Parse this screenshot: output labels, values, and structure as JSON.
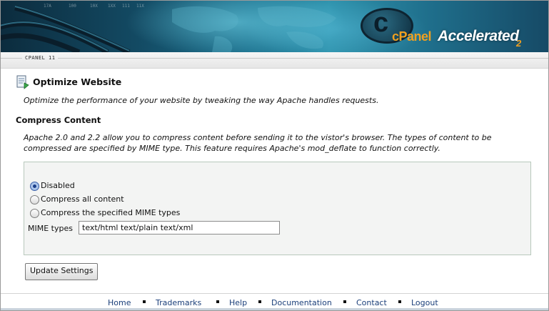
{
  "header": {
    "logo_c": "c",
    "logo_cpanel": "cPanel",
    "logo_accelerated": "Accelerated",
    "logo_version_num": "2",
    "version_strip": "CPANEL 11"
  },
  "page": {
    "title": "Optimize Website",
    "description": "Optimize the performance of your website by tweaking the way Apache handles requests."
  },
  "compress": {
    "section_title": "Compress Content",
    "section_description": "Apache 2.0 and 2.2 allow you to compress content before sending it to the vistor's browser. The types of content to be compressed are specified by MIME type. This feature requires Apache's mod_deflate to function correctly.",
    "options": [
      {
        "label": "Disabled",
        "selected": true
      },
      {
        "label": "Compress all content",
        "selected": false
      },
      {
        "label": "Compress the specified MIME types",
        "selected": false
      }
    ],
    "mime_label": "MIME types",
    "mime_value": "text/html text/plain text/xml",
    "update_button": "Update Settings"
  },
  "footer": {
    "links": [
      "Home",
      "Trademarks",
      "Help",
      "Documentation",
      "Contact",
      "Logout"
    ]
  },
  "icons": {
    "page_icon": "optimize-page-icon"
  },
  "colors": {
    "link": "#1b3f7a",
    "options_bg": "#f3f4f3",
    "options_border": "#b8c8bc"
  }
}
